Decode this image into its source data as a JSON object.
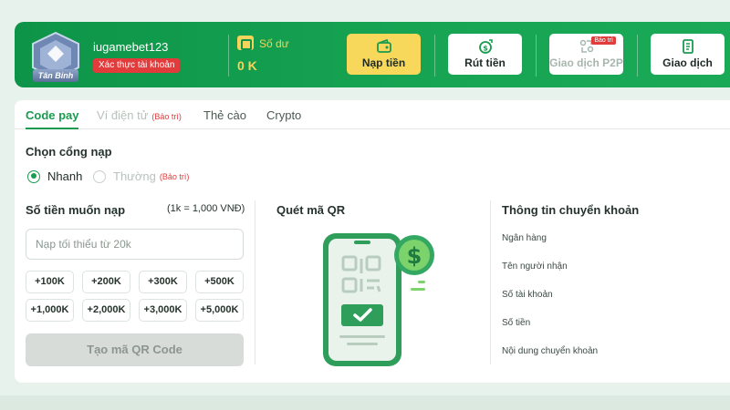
{
  "header": {
    "rank_label": "Tân Binh",
    "username": "iugamebet123",
    "verify_label": "Xác thực tài khoản",
    "balance_label": "Số dư",
    "balance_value": "0 K",
    "buttons": [
      {
        "label": "Nạp tiền",
        "icon": "wallet-icon",
        "state": "active"
      },
      {
        "label": "Rút tiền",
        "icon": "money-out-icon",
        "state": "normal"
      },
      {
        "label": "Giao dịch P2P",
        "icon": "p2p-icon",
        "state": "disabled",
        "badge": "Bảo trì"
      },
      {
        "label": "Giao dịch",
        "icon": "receipt-icon",
        "state": "normal"
      }
    ]
  },
  "tabs": [
    {
      "label": "Code pay",
      "state": "active"
    },
    {
      "label": "Ví điện tử",
      "state": "disabled",
      "badge": "(Bảo trì)"
    },
    {
      "label": "Thẻ cào",
      "state": "normal"
    },
    {
      "label": "Crypto",
      "state": "normal"
    }
  ],
  "gateway": {
    "title": "Chọn cổng nạp",
    "options": [
      {
        "label": "Nhanh",
        "selected": true
      },
      {
        "label": "Thường",
        "selected": false,
        "badge": "(Bảo trì)"
      }
    ]
  },
  "amount": {
    "title": "Số tiền muốn nạp",
    "rate": "(1k = 1,000 VNĐ)",
    "placeholder": "Nạp tối thiểu từ 20k",
    "chips": [
      "+100K",
      "+200K",
      "+300K",
      "+500K",
      "+1,000K",
      "+2,000K",
      "+3,000K",
      "+5,000K"
    ],
    "submit_label": "Tạo mã QR Code"
  },
  "qr": {
    "title": "Quét mã QR"
  },
  "transfer_info": {
    "title": "Thông tin chuyển khoản",
    "fields": [
      "Ngân hàng",
      "Tên người nhận",
      "Số tài khoản",
      "Số tiền",
      "Nội dung chuyển khoản"
    ]
  },
  "colors": {
    "brand_green": "#17a553",
    "accent_yellow": "#f8d85a",
    "maintenance_red": "#e23b3b"
  }
}
